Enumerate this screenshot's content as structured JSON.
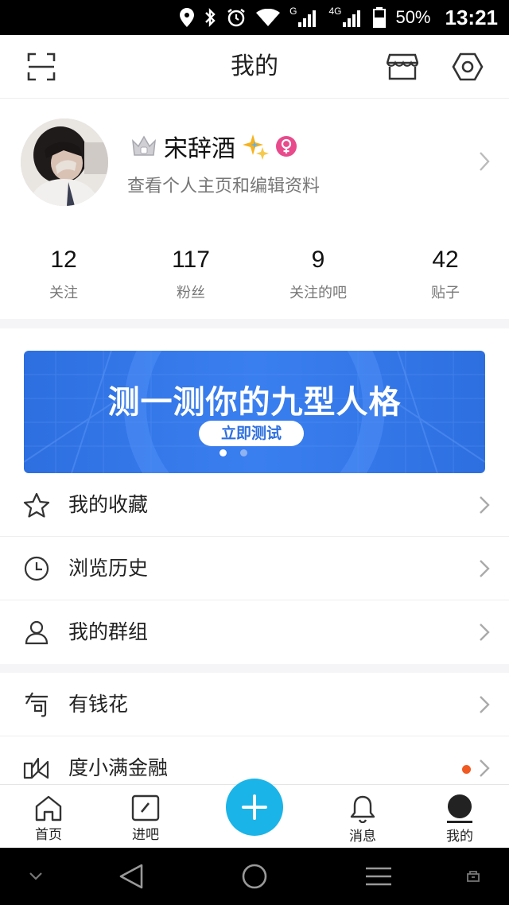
{
  "status_bar": {
    "network_g": "G",
    "network_4g": "4G",
    "battery": "50%",
    "time": "13:21"
  },
  "header": {
    "title": "我的"
  },
  "profile": {
    "name": "宋辞酒",
    "subtitle": "查看个人主页和编辑资料"
  },
  "stats": [
    {
      "value": "12",
      "label": "关注"
    },
    {
      "value": "117",
      "label": "粉丝"
    },
    {
      "value": "9",
      "label": "关注的吧"
    },
    {
      "value": "42",
      "label": "贴子"
    }
  ],
  "banner": {
    "title": "测一测你的九型人格",
    "button": "立即测试",
    "page_count": 2,
    "active_page": 1
  },
  "menu_group_1": [
    {
      "label": "我的收藏",
      "icon": "star-icon"
    },
    {
      "label": "浏览历史",
      "icon": "clock-icon"
    },
    {
      "label": "我的群组",
      "icon": "group-user-icon"
    }
  ],
  "menu_group_2": [
    {
      "label": "有钱花",
      "icon": "youqianhua-icon"
    },
    {
      "label": "度小满金融",
      "icon": "duxiaoman-icon",
      "badge_dot": true
    }
  ],
  "tabbar": {
    "items": [
      {
        "label": "首页",
        "icon": "home-icon"
      },
      {
        "label": "进吧",
        "icon": "enter-bar-icon"
      },
      {
        "label": "消息",
        "icon": "bell-icon"
      },
      {
        "label": "我的",
        "icon": "profile-icon",
        "active": true
      }
    ]
  },
  "colors": {
    "accent": "#1ab4e8",
    "banner_blue": "#2d6fe0",
    "notify_dot": "#f05a22",
    "female_badge": "#e84a8c"
  }
}
